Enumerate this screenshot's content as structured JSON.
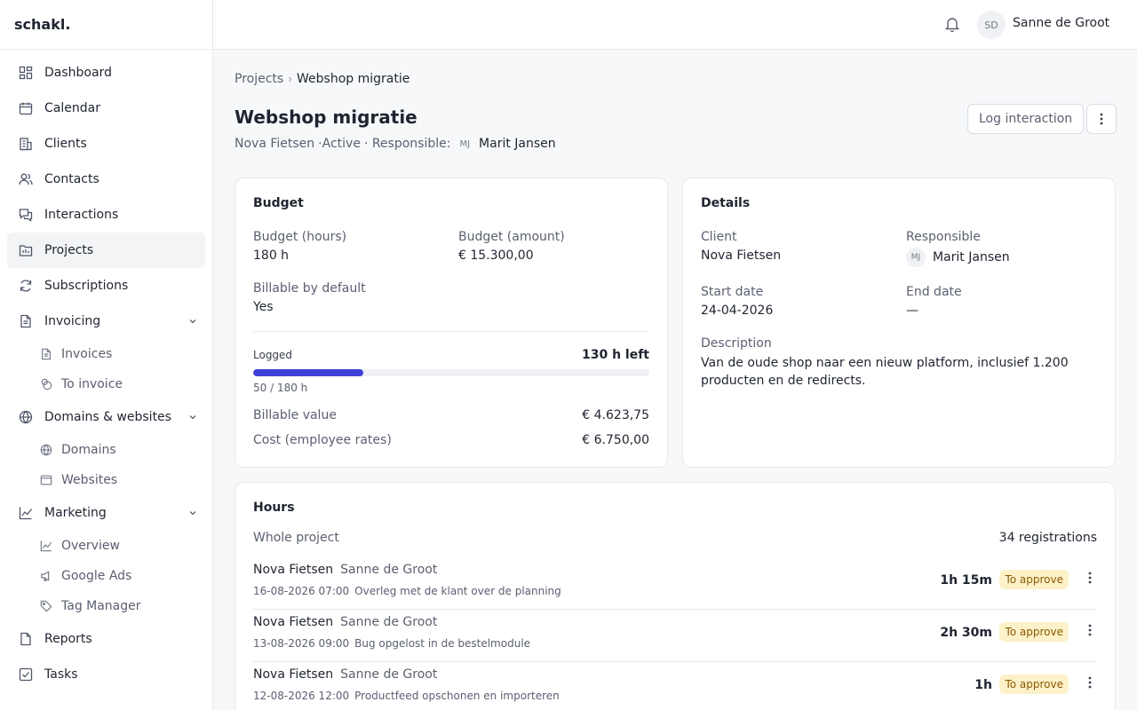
{
  "app": {
    "logo": "schakl."
  },
  "sidebar": {
    "items": [
      {
        "label": "Dashboard",
        "icon": "dashboard-icon"
      },
      {
        "label": "Calendar",
        "icon": "calendar-icon"
      },
      {
        "label": "Clients",
        "icon": "building-icon"
      },
      {
        "label": "Contacts",
        "icon": "users-icon"
      },
      {
        "label": "Interactions",
        "icon": "chat-icon"
      },
      {
        "label": "Projects",
        "icon": "folder-icon",
        "active": true
      },
      {
        "label": "Subscriptions",
        "icon": "refresh-icon"
      },
      {
        "label": "Invoicing",
        "icon": "file-icon",
        "expanded": true,
        "children": [
          {
            "label": "Invoices",
            "icon": "file-icon"
          },
          {
            "label": "To invoice",
            "icon": "coins-icon"
          }
        ]
      },
      {
        "label": "Domains & websites",
        "icon": "globe-icon",
        "expanded": true,
        "children": [
          {
            "label": "Domains",
            "icon": "globe-icon"
          },
          {
            "label": "Websites",
            "icon": "browser-icon"
          }
        ]
      },
      {
        "label": "Marketing",
        "icon": "chart-icon",
        "expanded": true,
        "children": [
          {
            "label": "Overview",
            "icon": "chart-icon"
          },
          {
            "label": "Google Ads",
            "icon": "megaphone-icon"
          },
          {
            "label": "Tag Manager",
            "icon": "tag-icon"
          }
        ]
      },
      {
        "label": "Reports",
        "icon": "report-icon"
      },
      {
        "label": "Tasks",
        "icon": "checkbox-icon"
      }
    ]
  },
  "topbar": {
    "avatar_initials": "SD",
    "user_name": "Sanne de Groot"
  },
  "breadcrumb": {
    "parent": "Projects",
    "separator": "›",
    "current": "Webshop migratie"
  },
  "project": {
    "title": "Webshop migratie",
    "client": "Nova Fietsen",
    "status": "·Active",
    "responsible_prefix": "· Responsible:",
    "responsible_initials": "MJ",
    "responsible_name": "Marit Jansen"
  },
  "actions": {
    "log_interaction": "Log interaction"
  },
  "budget": {
    "title": "Budget",
    "hours_label": "Budget (hours)",
    "hours_value": "180 h",
    "amount_label": "Budget (amount)",
    "amount_value": "€ 15.300,00",
    "billable_label": "Billable by default",
    "billable_value": "Yes",
    "logged_label": "Logged",
    "left_value": "130 h left",
    "logged_fraction": 0.278,
    "logged_caption": "50 / 180 h",
    "billable_value_label": "Billable value",
    "billable_value_amount": "€ 4.623,75",
    "cost_label": "Cost (employee rates)",
    "cost_amount": "€ 6.750,00"
  },
  "details": {
    "title": "Details",
    "client_label": "Client",
    "client_value": "Nova Fietsen",
    "responsible_label": "Responsible",
    "responsible_initials": "MJ",
    "responsible_value": "Marit Jansen",
    "start_label": "Start date",
    "start_value": "24-04-2026",
    "end_label": "End date",
    "end_value": "—",
    "description_label": "Description",
    "description_line1": "Van de oude shop naar een nieuw platform, inclusief 1.200",
    "description_line2": "producten en de redirects."
  },
  "hours": {
    "title": "Hours",
    "scope": "Whole project",
    "count": "34 registrations",
    "rows": [
      {
        "client": "Nova Fietsen",
        "employee": "Sanne de Groot",
        "datetime": "16-08-2026 07:00",
        "description": "Overleg met de klant over de planning",
        "duration": "1h 15m",
        "status": "To approve"
      },
      {
        "client": "Nova Fietsen",
        "employee": "Sanne de Groot",
        "datetime": "13-08-2026 09:00",
        "description": "Bug opgelost in de bestelmodule",
        "duration": "2h 30m",
        "status": "To approve"
      },
      {
        "client": "Nova Fietsen",
        "employee": "Sanne de Groot",
        "datetime": "12-08-2026 12:00",
        "description": "Productfeed opschonen en importeren",
        "duration": "1h",
        "status": "To approve"
      }
    ]
  },
  "colors": {
    "accent": "#3f3fd8",
    "badge_bg": "#fdf1c9",
    "badge_text": "#8a5a00"
  }
}
